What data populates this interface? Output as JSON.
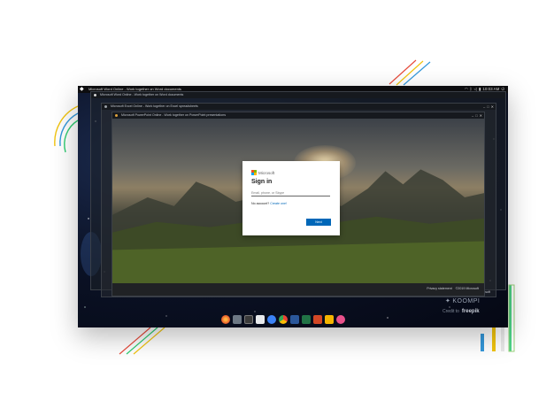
{
  "topbar": {
    "window_title": "Microsoft Word Online - Work together on Word documents",
    "clock": "10:03 AM",
    "tray_icons": [
      "wifi-icon",
      "bluetooth-icon",
      "volume-icon",
      "battery-icon",
      "power-icon"
    ]
  },
  "windows": [
    {
      "title": "Microsoft Word Online - Work together on Word documents"
    },
    {
      "title": "Microsoft Excel Online - Work together on Excel spreadsheets"
    },
    {
      "title": "Microsoft PowerPoint Online - Work together on PowerPoint presentations"
    }
  ],
  "footer": {
    "privacy": "Privacy statement",
    "copyright": "©2019 Microsoft"
  },
  "signin": {
    "brand": "Microsoft",
    "title": "Sign in",
    "email_placeholder": "Email, phone, or Skype",
    "no_account": "No account?",
    "create_one": "Create one!",
    "next": "Next"
  },
  "dock": {
    "apps": [
      "firefox-icon",
      "files-icon",
      "terminal-icon",
      "store-icon",
      "settings-icon",
      "chrome-icon",
      "word-icon",
      "excel-icon",
      "powerpoint-icon",
      "slides-icon",
      "screenshot-icon"
    ]
  },
  "branding": {
    "koompi": "KOOMPI",
    "credit_to": "Credit to",
    "freepik": "freepik"
  },
  "colors": {
    "accent_blue": "#0067b8",
    "ms_red": "#f25022",
    "ms_green": "#7fba00",
    "ms_blue": "#00a4ef",
    "ms_yellow": "#ffb900"
  }
}
